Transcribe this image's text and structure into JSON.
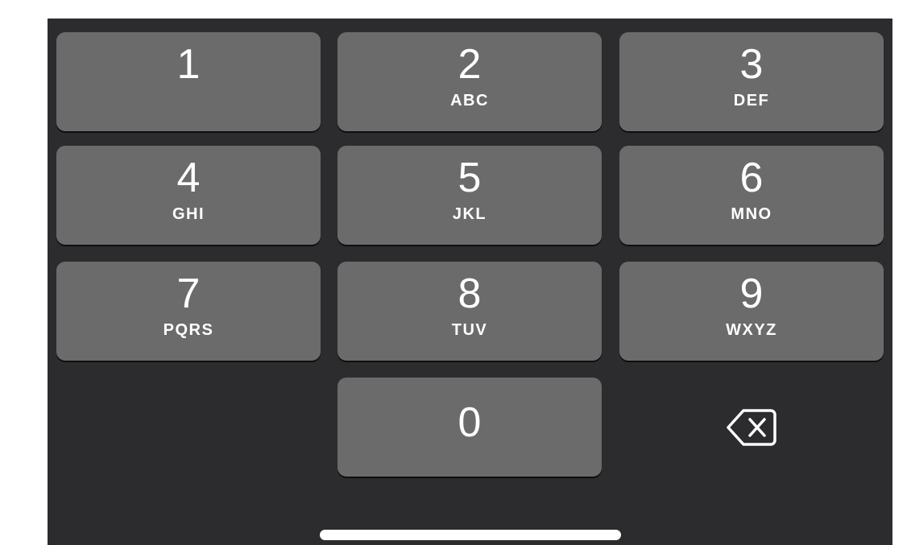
{
  "keypad": {
    "keys": [
      {
        "digit": "1",
        "letters": ""
      },
      {
        "digit": "2",
        "letters": "ABC"
      },
      {
        "digit": "3",
        "letters": "DEF"
      },
      {
        "digit": "4",
        "letters": "GHI"
      },
      {
        "digit": "5",
        "letters": "JKL"
      },
      {
        "digit": "6",
        "letters": "MNO"
      },
      {
        "digit": "7",
        "letters": "PQRS"
      },
      {
        "digit": "8",
        "letters": "TUV"
      },
      {
        "digit": "9",
        "letters": "WXYZ"
      },
      {
        "digit": "0",
        "letters": ""
      }
    ],
    "backspace_icon": "backspace-icon"
  },
  "colors": {
    "keyboard_background": "#2c2c2e",
    "key_background": "#6b6b6b",
    "text": "#ffffff"
  }
}
